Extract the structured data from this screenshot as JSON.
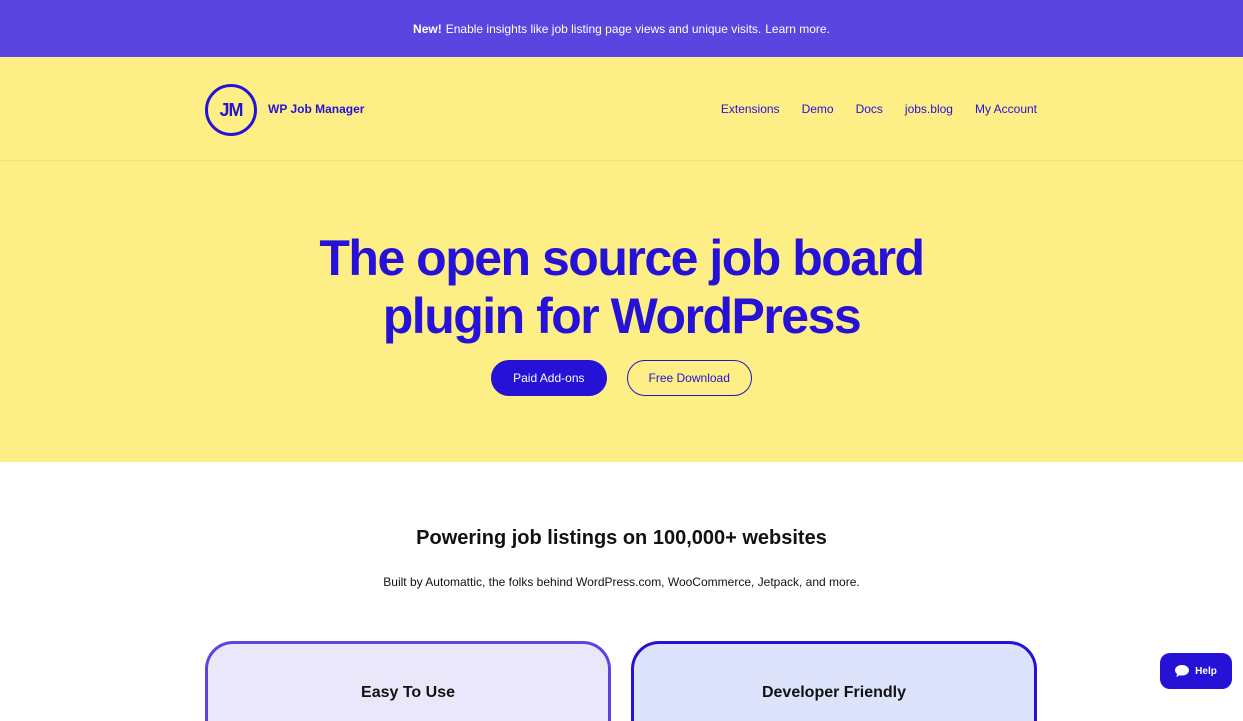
{
  "banner": {
    "new_label": "New!",
    "text": "Enable insights like job listing page views and unique visits.",
    "link": "Learn more."
  },
  "header": {
    "logo_initials": "JM",
    "logo_text": "WP Job Manager",
    "nav": [
      "Extensions",
      "Demo",
      "Docs",
      "jobs.blog",
      "My Account"
    ]
  },
  "hero": {
    "headline_line1": "The open source job board",
    "headline_line2": "plugin for WordPress",
    "primary_button": "Paid Add-ons",
    "secondary_button": "Free Download"
  },
  "stats": {
    "title": "Powering job listings on 100,000+ websites",
    "subtitle": "Built by Automattic, the folks behind WordPress.com, WooCommerce, Jetpack, and more."
  },
  "features": {
    "cards": [
      "Easy To Use",
      "Developer Friendly"
    ]
  },
  "help": {
    "label": "Help",
    "icon": "chat-bubble-icon"
  },
  "colors": {
    "brand": "#2612d6",
    "banner": "#5b45e0",
    "hero_bg": "#fdee85"
  }
}
